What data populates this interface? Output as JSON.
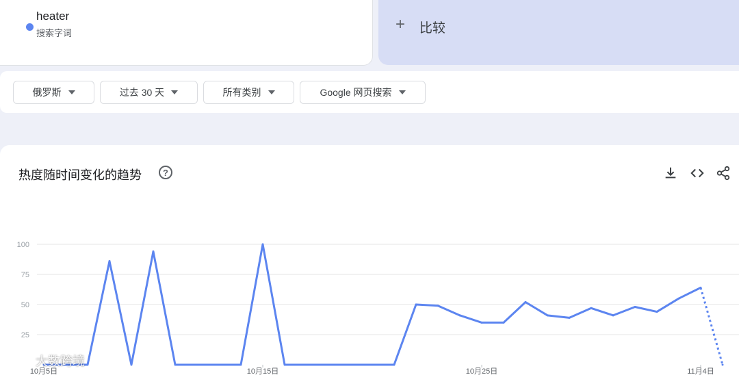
{
  "term": {
    "name": "heater",
    "subtitle": "搜索字词",
    "color": "#5c85f0"
  },
  "compare": {
    "plus": "+",
    "label": "比较"
  },
  "filters": [
    {
      "label": "俄罗斯"
    },
    {
      "label": "过去 30 天"
    },
    {
      "label": "所有类别"
    },
    {
      "label": "Google 网页搜索"
    }
  ],
  "chart_card": {
    "title": "热度随时间变化的趋势",
    "help": "?"
  },
  "watermark": {
    "text": "大数跨境"
  },
  "chart_data": {
    "type": "line",
    "title": "热度随时间变化的趋势",
    "y_ticks": [
      "25",
      "50",
      "75",
      "100"
    ],
    "ylim": [
      0,
      100
    ],
    "x_tick_labels": [
      {
        "label": "10月5日",
        "index": 0
      },
      {
        "label": "10月15日",
        "index": 10
      },
      {
        "label": "10月25日",
        "index": 20
      },
      {
        "label": "11月4日",
        "index": 30
      }
    ],
    "series": [
      {
        "color": "#5c85f0",
        "values": [
          0,
          0,
          0,
          86,
          0,
          94,
          0,
          0,
          0,
          0,
          100,
          0,
          0,
          0,
          0,
          0,
          0,
          50,
          49,
          41,
          35,
          35,
          52,
          41,
          39,
          47,
          41,
          48,
          44,
          55,
          64,
          0
        ],
        "partial_from_index": 30
      }
    ],
    "grid": true
  }
}
